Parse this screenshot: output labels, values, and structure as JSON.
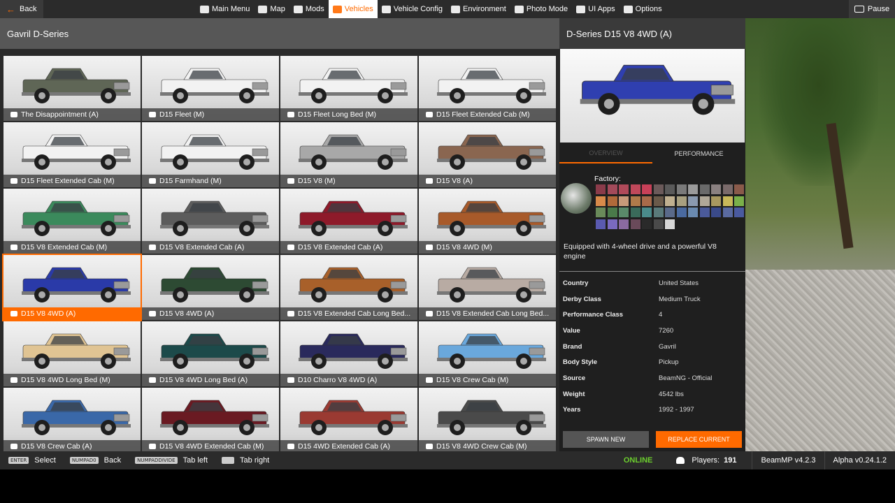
{
  "topbar": {
    "back_label": "Back",
    "nav": [
      {
        "label": "Main Menu",
        "icon": "main-menu-icon",
        "active": false
      },
      {
        "label": "Map",
        "icon": "map-icon",
        "active": false
      },
      {
        "label": "Mods",
        "icon": "mods-icon",
        "active": false
      },
      {
        "label": "Vehicles",
        "icon": "car-icon",
        "active": true
      },
      {
        "label": "Vehicle Config",
        "icon": "vehicle-config-icon",
        "active": false
      },
      {
        "label": "Environment",
        "icon": "environment-icon",
        "active": false
      },
      {
        "label": "Photo Mode",
        "icon": "camera-icon",
        "active": false
      },
      {
        "label": "UI Apps",
        "icon": "ui-apps-icon",
        "active": false
      },
      {
        "label": "Options",
        "icon": "options-icon",
        "active": false
      }
    ],
    "pause_label": "Pause"
  },
  "list": {
    "title": "Gavril D-Series",
    "configs": [
      {
        "label": "The Disappointment (A)",
        "color": "#5f6656",
        "selected": false
      },
      {
        "label": "D15 Fleet (M)",
        "color": "#f2f2f2",
        "selected": false
      },
      {
        "label": "D15 Fleet Long Bed (M)",
        "color": "#f2f2f2",
        "selected": false
      },
      {
        "label": "D15 Fleet Extended Cab (M)",
        "color": "#f2f2f2",
        "selected": false
      },
      {
        "label": "D15 Fleet Extended Cab (M)",
        "color": "#f2f2f2",
        "selected": false
      },
      {
        "label": "D15 Farmhand (M)",
        "color": "#f2f2f2",
        "selected": false
      },
      {
        "label": "D15 V8 (M)",
        "color": "#a8a8a8",
        "selected": false
      },
      {
        "label": "D15 V8 (A)",
        "color": "#8a6650",
        "selected": false
      },
      {
        "label": "D15 V8 Extended Cab (M)",
        "color": "#3b8a5c",
        "selected": false
      },
      {
        "label": "D15 V8 Extended Cab (A)",
        "color": "#5c5c5c",
        "selected": false
      },
      {
        "label": "D15 V8 Extended Cab (A)",
        "color": "#8e1a2a",
        "selected": false
      },
      {
        "label": "D15 V8 4WD (M)",
        "color": "#a85a2a",
        "selected": false
      },
      {
        "label": "D15 V8 4WD (A)",
        "color": "#2a3aa8",
        "selected": true
      },
      {
        "label": "D15 V8 4WD (A)",
        "color": "#2d4a33",
        "selected": false
      },
      {
        "label": "D15 V8 Extended Cab Long Bed...",
        "color": "#a8602a",
        "selected": false
      },
      {
        "label": "D15 V8 Extended Cab Long Bed...",
        "color": "#b8aba3",
        "selected": false
      },
      {
        "label": "D15 V8 4WD Long Bed (M)",
        "color": "#e0c493",
        "selected": false
      },
      {
        "label": "D15 V8 4WD Long Bed (A)",
        "color": "#1c4a4a",
        "selected": false
      },
      {
        "label": "D10 Charro V8 4WD (A)",
        "color": "#2a2a5c",
        "selected": false
      },
      {
        "label": "D15 V8 Crew Cab (M)",
        "color": "#6aa8dc",
        "selected": false
      },
      {
        "label": "D15 V8 Crew Cab (A)",
        "color": "#3a68a8",
        "selected": false
      },
      {
        "label": "D15 V8 4WD Extended Cab (M)",
        "color": "#6a1a22",
        "selected": false
      },
      {
        "label": "D15 4WD Extended Cab (A)",
        "color": "#9a3a32",
        "selected": false
      },
      {
        "label": "D15 V8 4WD Crew Cab (M)",
        "color": "#4a4a4a",
        "selected": false
      }
    ]
  },
  "detail": {
    "title": "D-Series D15 V8 4WD (A)",
    "preview_color": "#2f3fb0",
    "tabs": {
      "overview": "OVERVIEW",
      "performance": "PERFORMANCE"
    },
    "factory_label": "Factory:",
    "swatches": [
      "#8a3b4a",
      "#a34a5a",
      "#b04a5a",
      "#c0485a",
      "#c84058",
      "#6b5a5a",
      "#5a5a5a",
      "#7a7a7a",
      "#9a9a9a",
      "#6a6a6a",
      "#8a8080",
      "#7a6a6a",
      "#8a5a4a",
      "#d88a4a",
      "#b06a3a",
      "#c89a7a",
      "#b07a4a",
      "#a86a4a",
      "#6a5a4a",
      "#c0b090",
      "#a8a080",
      "#8a9ab0",
      "#b0a898",
      "#a89860",
      "#c8b85a",
      "#7ab04a",
      "#6a8a5a",
      "#4a7a4a",
      "#5a8a6a",
      "#3a6a5a",
      "#4a8a8a",
      "#5a7a7a",
      "#5a6a8a",
      "#4a6aa0",
      "#6a8ab0",
      "#4a5a9a",
      "#3a4a8a",
      "#5a6aa0",
      "#4a5aa0",
      "#5a5ab0",
      "#7a6ac0",
      "#8a6aa0",
      "#6a4a5a",
      "#2a2a2a",
      "#4a4a4a",
      "#d8d8d8"
    ],
    "description": "Equipped with 4-wheel drive and a powerful V8 engine",
    "specs": [
      {
        "key": "Country",
        "value": "United States"
      },
      {
        "key": "Derby Class",
        "value": "Medium Truck"
      },
      {
        "key": "Performance Class",
        "value": "4"
      },
      {
        "key": "Value",
        "value": "7260"
      },
      {
        "key": "Brand",
        "value": "Gavril"
      },
      {
        "key": "Body Style",
        "value": "Pickup"
      },
      {
        "key": "Source",
        "value": "BeamNG - Official"
      },
      {
        "key": "Weight",
        "value": "4542 lbs"
      },
      {
        "key": "Years",
        "value": "1992 - 1997"
      }
    ],
    "spawn_new_label": "SPAWN NEW",
    "replace_current_label": "REPLACE CURRENT"
  },
  "bottombar": {
    "hints": [
      {
        "key": "ENTER",
        "label": "Select"
      },
      {
        "key": "NUMPAD0",
        "label": "Back"
      },
      {
        "key": "NUMPADDIVIDE",
        "label": "Tab left"
      },
      {
        "key": "",
        "label": "Tab right"
      }
    ],
    "status": "ONLINE",
    "players_label": "Players:",
    "players_count": "191",
    "beammp_version": "BeamMP v4.2.3",
    "game_version": "Alpha v0.24.1.2"
  },
  "colors": {
    "accent": "#ff6a00",
    "online": "#6ccf2e"
  }
}
